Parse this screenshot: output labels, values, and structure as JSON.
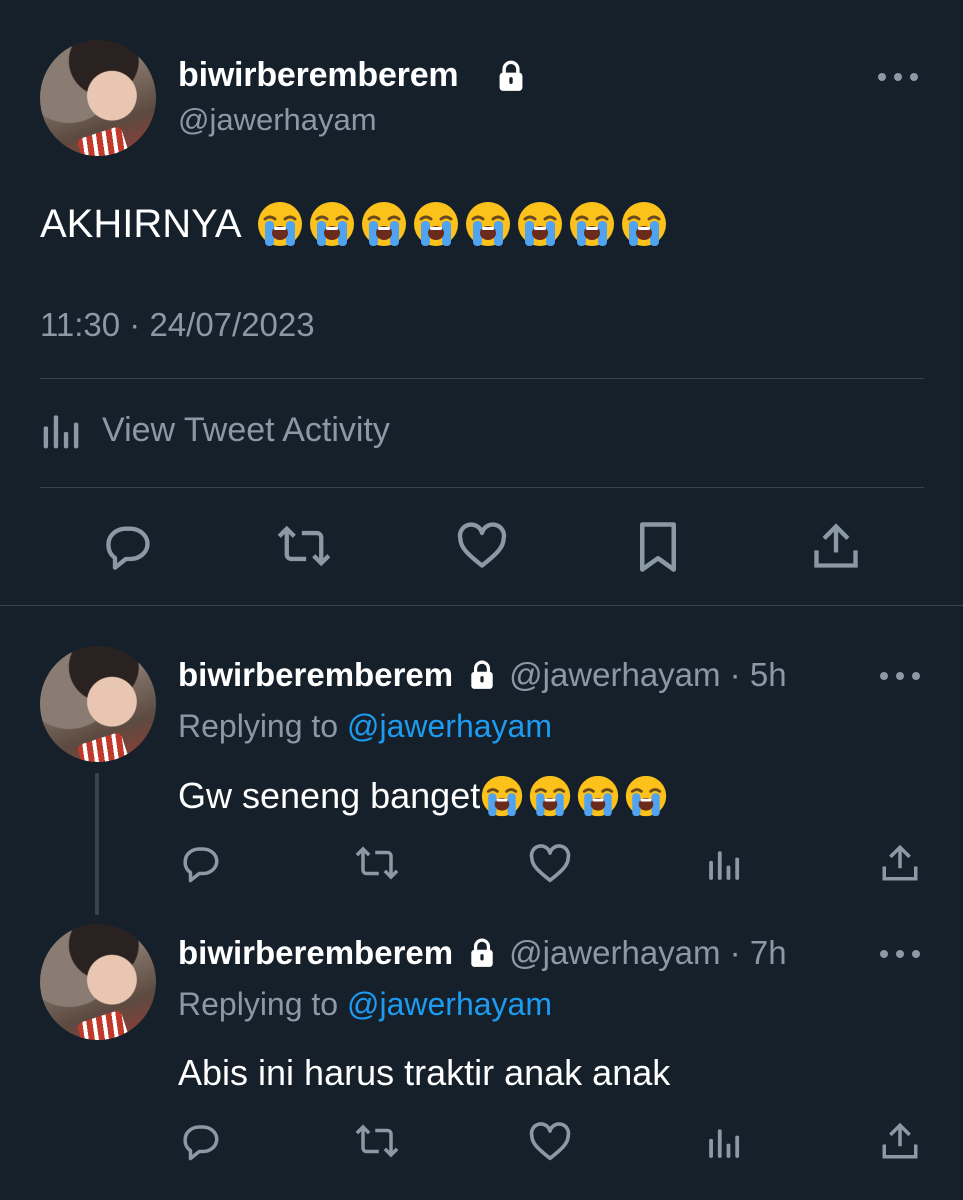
{
  "main_tweet": {
    "display_name": "biwirberemberem",
    "handle": "@jawerhayam",
    "text": "AKHIRNYA",
    "emoji_count": 8,
    "emoji_icon": "loudly-crying-face",
    "timestamp": "11:30 · 24/07/2023",
    "activity_label": "View Tweet Activity"
  },
  "replies": [
    {
      "display_name": "biwirberemberem",
      "handle_time": "@jawerhayam · 5h",
      "replying_prefix": "Replying to",
      "replying_handle": "@jawerhayam",
      "text": "Gw seneng banget",
      "emoji_count": 4
    },
    {
      "display_name": "biwirberemberem",
      "handle_time": "@jawerhayam · 7h",
      "replying_prefix": "Replying to",
      "replying_handle": "@jawerhayam",
      "text": "Abis ini harus traktir anak anak",
      "emoji_count": 0
    }
  ],
  "colors": {
    "background": "#15202b",
    "text_primary": "#ffffff",
    "text_secondary": "#8b98a5",
    "link": "#1d9bf0",
    "divider": "#38444d"
  }
}
